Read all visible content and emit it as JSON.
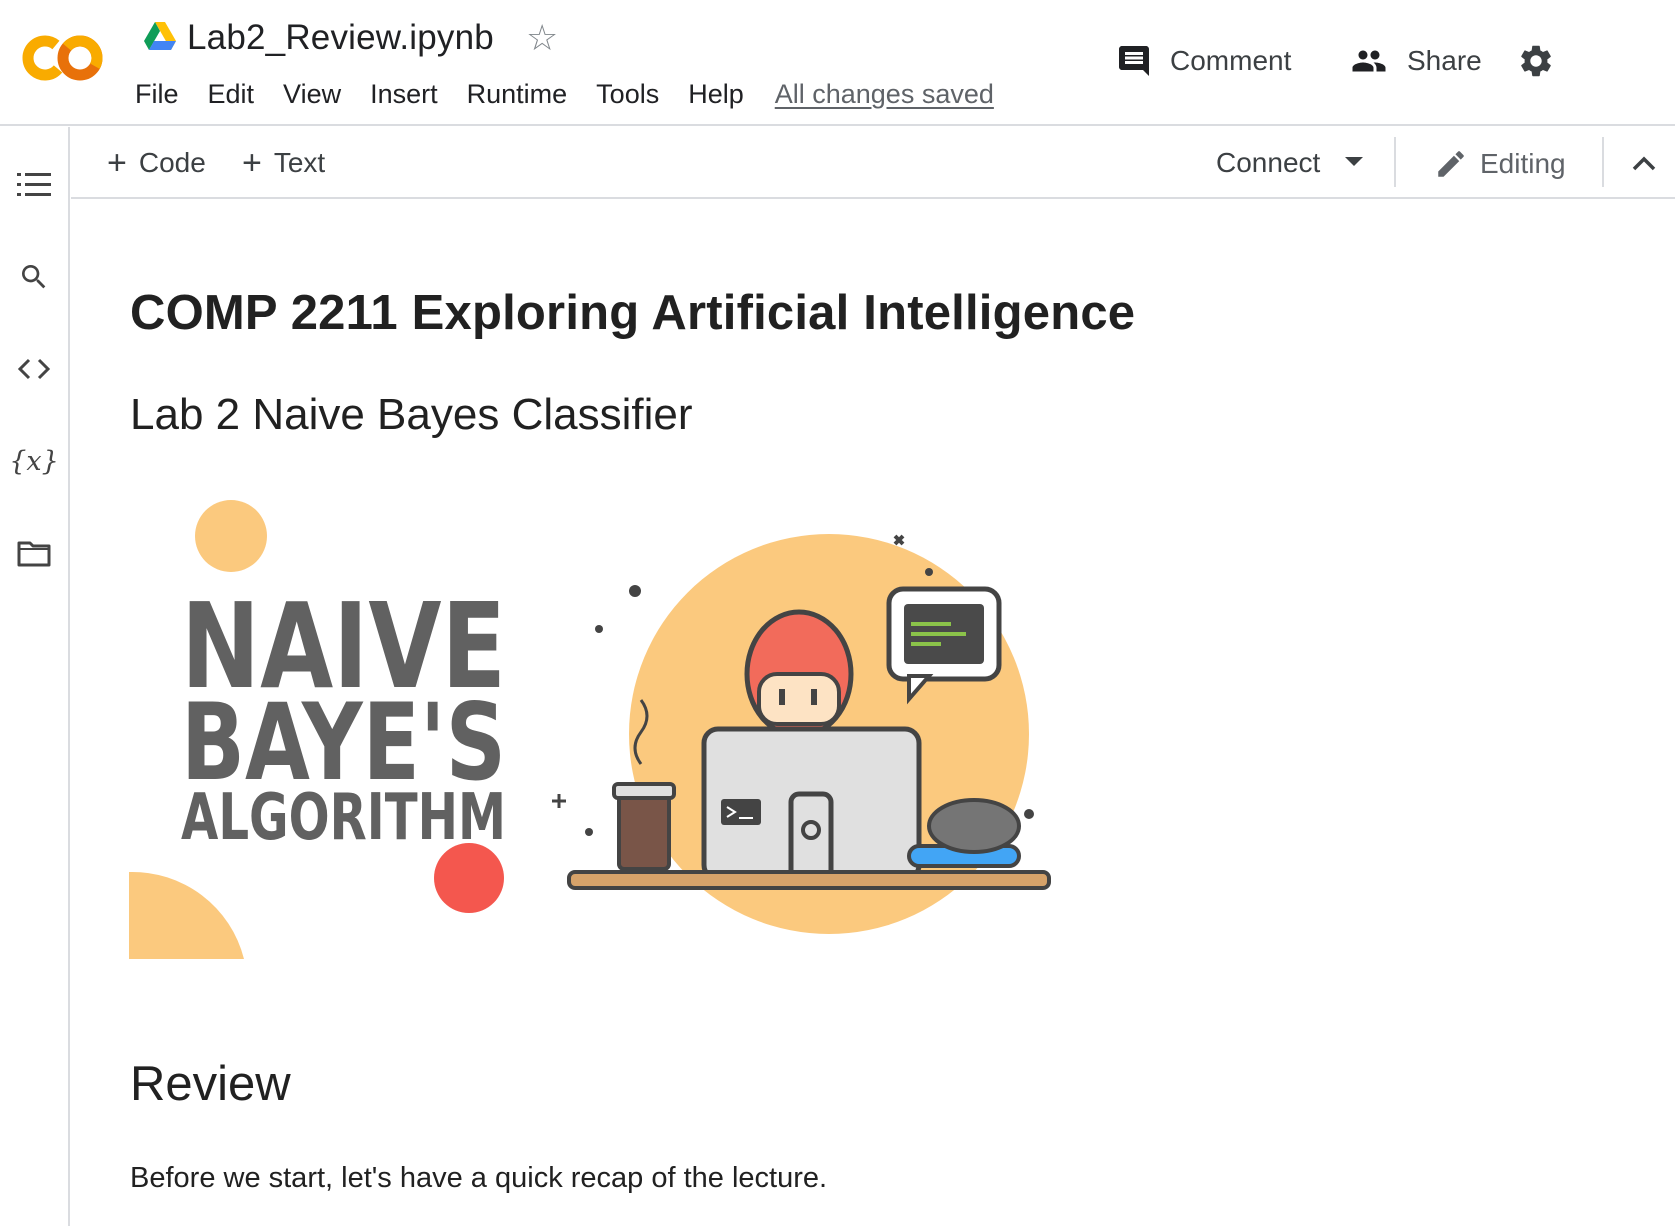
{
  "app": {
    "logo": "colab-logo",
    "notebook_title": "Lab2_Review.ipynb",
    "drive_icon": "google-drive-icon",
    "star_icon": "star-outline-icon"
  },
  "menu": {
    "items": [
      "File",
      "Edit",
      "View",
      "Insert",
      "Runtime",
      "Tools",
      "Help"
    ],
    "save_status": "All changes saved"
  },
  "header_actions": {
    "comment_label": "Comment",
    "share_label": "Share",
    "settings_icon": "gear-icon"
  },
  "sidebar": {
    "icons": [
      "table-of-contents-icon",
      "search-icon",
      "code-snippets-icon",
      "variables-icon",
      "folder-icon"
    ],
    "variables_glyph": "{x}"
  },
  "toolbar": {
    "add_code_label": "Code",
    "add_text_label": "Text",
    "connect_label": "Connect",
    "editing_label": "Editing"
  },
  "notebook": {
    "heading": "COMP 2211 Exploring Artificial Intelligence",
    "subheading": "Lab 2 Naive Bayes Classifier",
    "hero_image": {
      "line1": "NAIVE",
      "line2": "BAYE'S",
      "line3": "ALGORITHM"
    },
    "section_title": "Review",
    "intro_text": "Before we start, let's have a quick recap of the lecture."
  },
  "colors": {
    "colab_orange": "#F9AB00",
    "colab_orange_dark": "#E8710A",
    "peach": "#FBC97E",
    "coral": "#F4574E",
    "hero_text_gray": "#616161",
    "border": "#dadce0"
  }
}
